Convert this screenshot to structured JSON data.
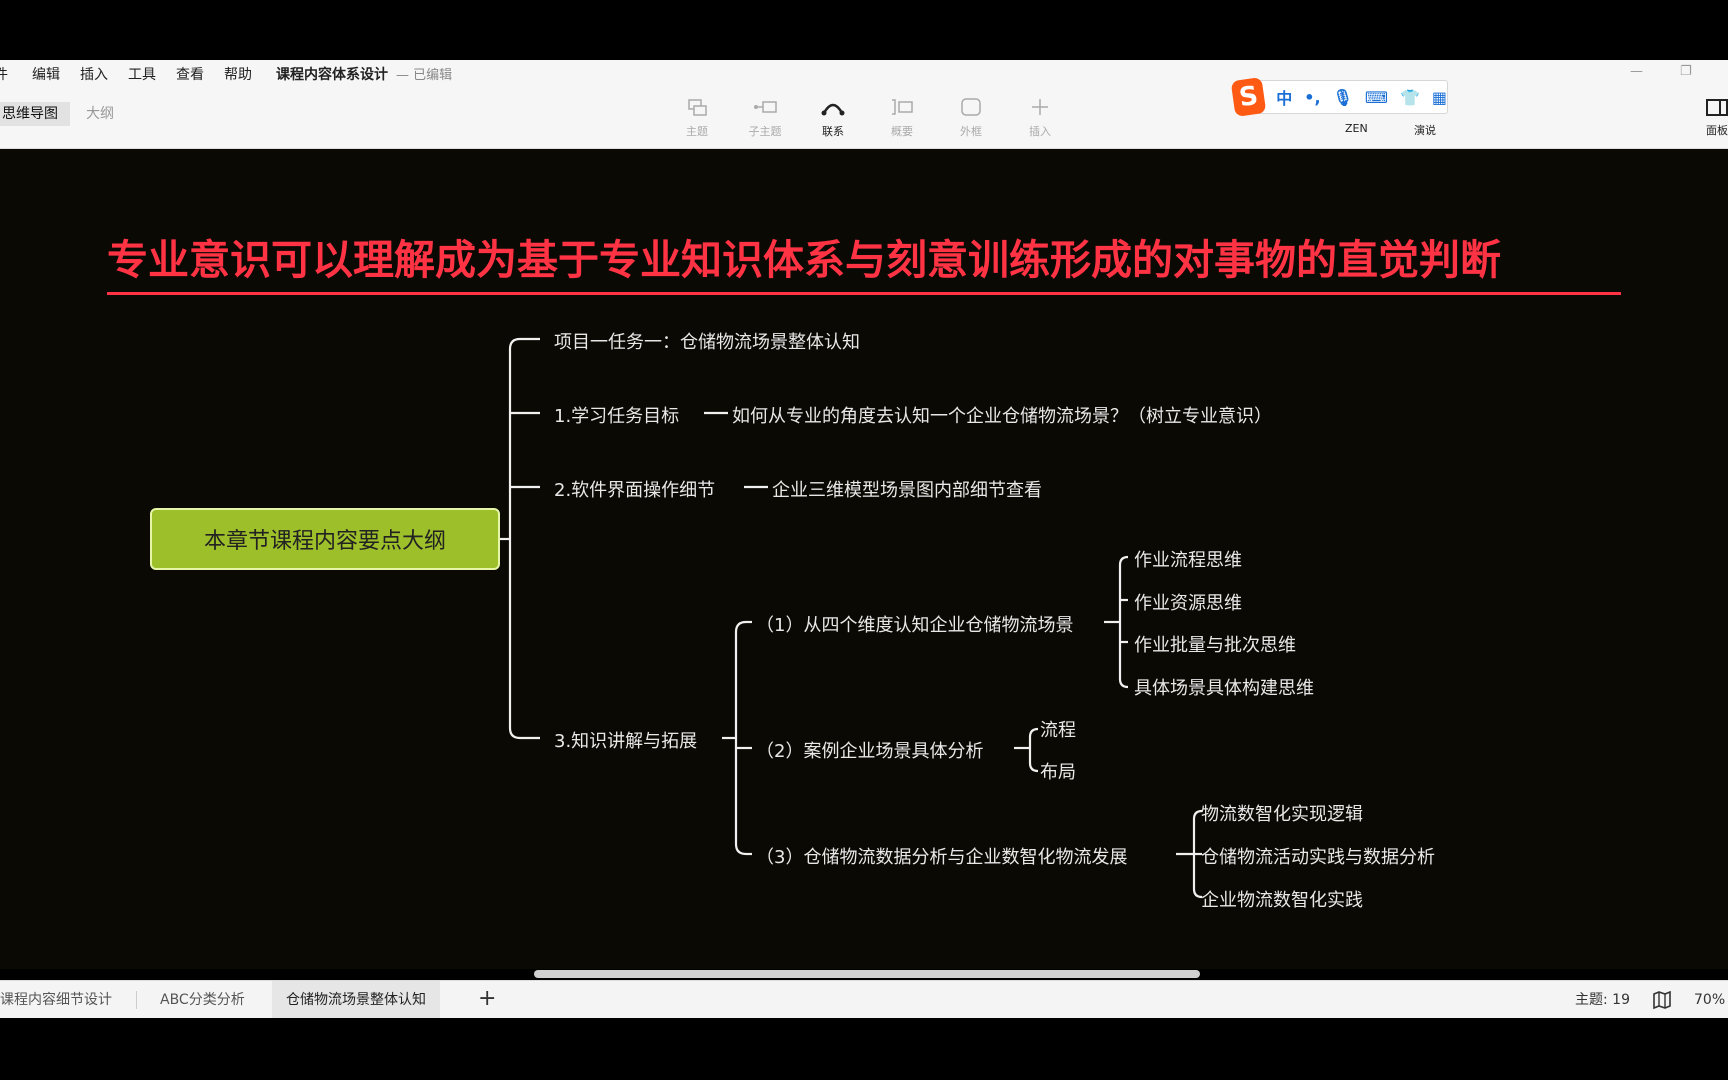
{
  "menubar": {
    "items": [
      "件",
      "编辑",
      "插入",
      "工具",
      "查看",
      "帮助"
    ],
    "doc_title": "课程内容体系设计",
    "doc_status": "— 已编辑"
  },
  "toolbar": {
    "view_tabs": [
      "思维导图",
      "大纲"
    ],
    "tools": [
      {
        "label": "主题",
        "icon": "topic-icon"
      },
      {
        "label": "子主题",
        "icon": "subtopic-icon"
      },
      {
        "label": "联系",
        "icon": "relationship-icon"
      },
      {
        "label": "概要",
        "icon": "summary-icon"
      },
      {
        "label": "外框",
        "icon": "boundary-icon"
      },
      {
        "label": "插入",
        "icon": "insert-icon"
      }
    ],
    "right_labels": [
      "ZEN",
      "演说",
      "面板"
    ],
    "ime_text": "中"
  },
  "canvas": {
    "headline": "专业意识可以理解成为基于专业知识体系与刻意训练形成的对事物的直觉判断",
    "root": "本章节课程内容要点大纲",
    "branch_1": "项目一任务一：仓储物流场景整体认知",
    "branch_2": "1.学习任务目标",
    "branch_2_child": "如何从专业的角度去认知一个企业仓储物流场景？（树立专业意识）",
    "branch_3": "2.软件界面操作细节",
    "branch_3_child": "企业三维模型场景图内部细节查看",
    "branch_4": "3.知识讲解与拓展",
    "sub_1": "（1）从四个维度认知企业仓储物流场景",
    "sub_1_children": [
      "作业流程思维",
      "作业资源思维",
      "作业批量与批次思维",
      "具体场景具体构建思维"
    ],
    "sub_2": "（2）案例企业场景具体分析",
    "sub_2_children": [
      "流程",
      "布局"
    ],
    "sub_3": "（3）仓储物流数据分析与企业数智化物流发展",
    "sub_3_children": [
      "物流数智化实现逻辑",
      "仓储物流活动实践与数据分析",
      "企业物流数智化实践"
    ]
  },
  "statusbar": {
    "sheets": [
      "课程内容细节设计",
      "ABC分类分析",
      "仓储物流场景整体认知"
    ],
    "add_label": "+",
    "topic_count": "主题: 19",
    "zoom": "70%"
  },
  "colors": {
    "headline": "#ff3344",
    "root_fill": "#9cbf2a",
    "canvas_bg": "#0b0903",
    "line": "#f0f0f0"
  }
}
